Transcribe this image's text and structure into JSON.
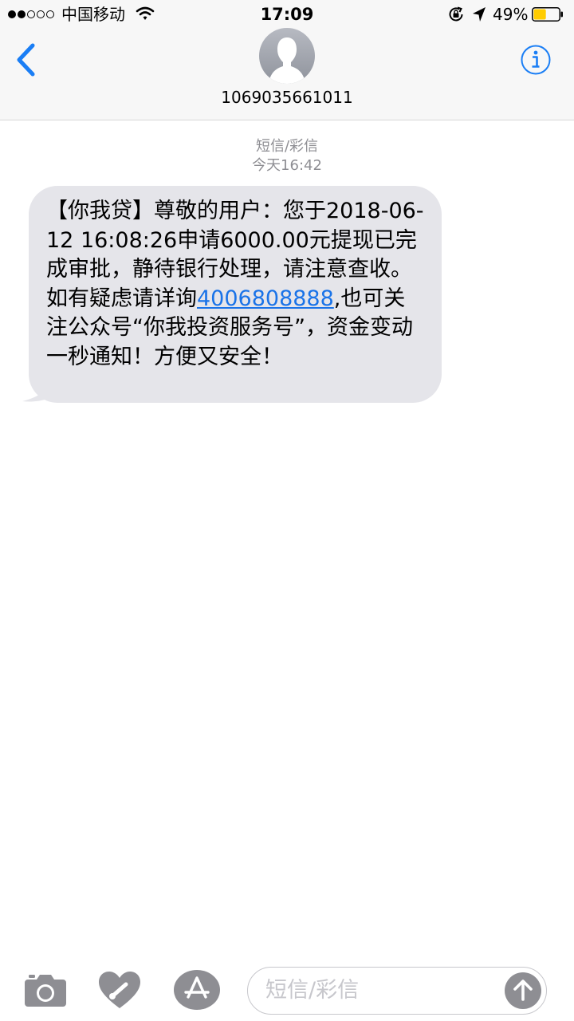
{
  "status_bar": {
    "signal_bars_filled": 2,
    "signal_bars_total": 5,
    "carrier": "中国移动",
    "time": "17:09",
    "battery_percent": "49%",
    "battery_level": 0.49,
    "battery_color": "#ffcc00"
  },
  "nav": {
    "contact_name": "1069035661011",
    "accent_color": "#1a7ef5",
    "back_icon": "chevron-left-icon",
    "info_icon": "info-icon"
  },
  "thread": {
    "message_type": "短信/彩信",
    "timestamp": "今天16:42",
    "message": {
      "text_before_link": "【你我贷】尊敬的用户：您于2018-06-12 16:08:26申请6000.00元提现已完成审批，静待银行处理，请注意查收。如有疑虑请详询",
      "phone_link": "4006808888",
      "text_after_link": ",也可关注公众号“你我投资服务号”，资金变动一秒通知！方便又安全！"
    }
  },
  "input_bar": {
    "placeholder": "短信/彩信",
    "camera_icon": "camera-icon",
    "digital_touch_icon": "digital-touch-heart-icon",
    "apps_icon": "app-store-icon",
    "send_icon": "arrow-up-icon"
  }
}
